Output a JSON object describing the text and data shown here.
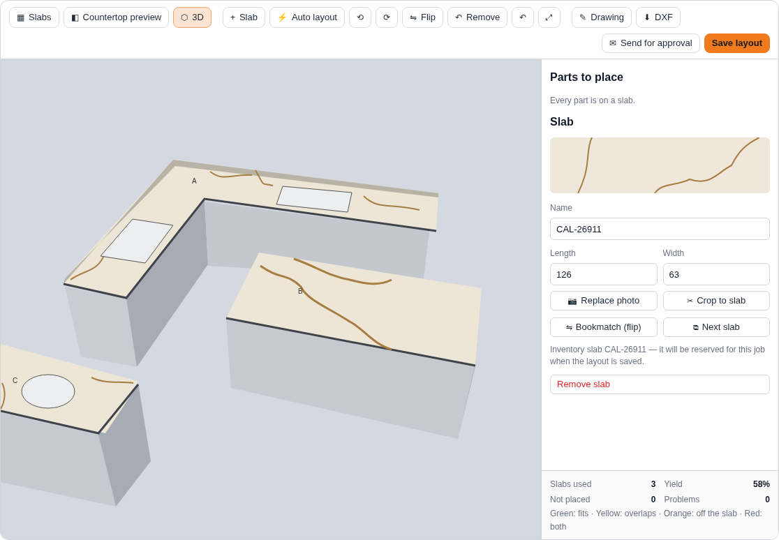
{
  "toolbar": {
    "groups": [
      [
        {
          "icon": "▦",
          "label": "Slabs",
          "selected": false
        },
        {
          "icon": "◧",
          "label": "Countertop preview",
          "selected": false
        },
        {
          "icon": "⬡",
          "label": "3D",
          "selected": true
        }
      ],
      [
        {
          "icon": "+",
          "label": "Slab",
          "selected": false
        },
        {
          "icon": "⚡",
          "label": "Auto layout",
          "selected": false
        },
        {
          "icon": "⟲",
          "selected": false
        },
        {
          "icon": "⟳",
          "selected": false
        },
        {
          "icon": "⇋",
          "label": "Flip",
          "selected": false
        },
        {
          "icon": "↶",
          "label": "Remove",
          "selected": false
        },
        {
          "icon": "↶",
          "selected": false
        },
        {
          "icon": "⤢",
          "selected": false
        }
      ],
      [
        {
          "icon": "✎",
          "label": "Drawing",
          "selected": false
        },
        {
          "icon": "⬇",
          "label": "DXF",
          "selected": false
        }
      ]
    ],
    "actions": [
      {
        "icon": "✉",
        "label": "Send for approval",
        "kind": "secondary"
      },
      {
        "label": "Save layout",
        "kind": "primary"
      }
    ]
  },
  "scene": {
    "part_labels": [
      "A",
      "B",
      "C"
    ]
  },
  "panel": {
    "parts_title": "Parts to place",
    "parts_note": "Every part is on a slab.",
    "slab_title": "Slab",
    "fields": [
      {
        "label": "Name",
        "value": "CAL-26911"
      },
      {
        "label": "Length",
        "value": "126"
      },
      {
        "label": "Width",
        "value": "63"
      }
    ],
    "buttons": [
      {
        "icon": "📷",
        "label": "Replace photo"
      },
      {
        "icon": "✂",
        "label": "Crop to slab"
      },
      {
        "icon": "⇋",
        "label": "Bookmatch (flip)"
      },
      {
        "icon": "⧉",
        "label": "Next slab"
      }
    ],
    "note": "Inventory slab CAL-26911 — it will be reserved for this job when the layout is saved.",
    "remove": "Remove slab"
  },
  "stats": [
    {
      "label": "Slabs used",
      "value": "3"
    },
    {
      "label": "Yield",
      "value": "58%"
    },
    {
      "label": "Not placed",
      "value": "0"
    },
    {
      "label": "Problems",
      "value": "0"
    }
  ],
  "legend": "Green: fits · Yellow: overlaps · Orange: off the slab · Red: both"
}
